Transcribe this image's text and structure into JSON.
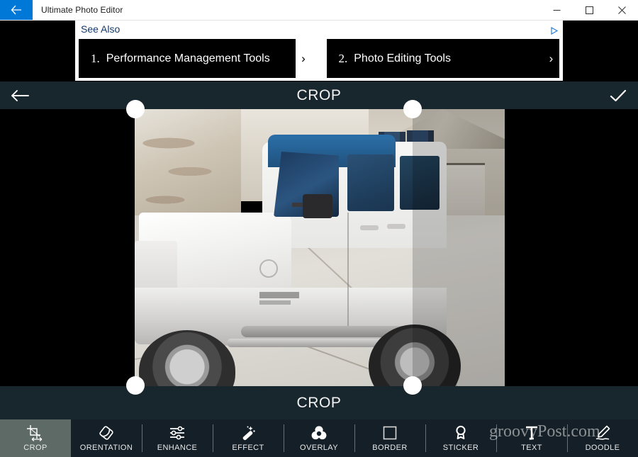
{
  "window": {
    "title": "Ultimate Photo Editor",
    "back_icon": "back-arrow-icon",
    "minimize_label": "─",
    "maximize_label": "□",
    "close_label": "✕"
  },
  "ad": {
    "heading": "See Also",
    "adchoices_icon": "adchoices-icon",
    "items": [
      {
        "number": "1.",
        "label": "Performance Management Tools",
        "arrow": "›"
      },
      {
        "number": "2.",
        "label": "Photo Editing Tools",
        "arrow": "›"
      }
    ]
  },
  "header": {
    "back_icon": "back-arrow-icon",
    "title": "CROP",
    "confirm_icon": "checkmark-icon"
  },
  "canvas": {
    "mode_label": "CROP",
    "handles": [
      "top-left",
      "top-right",
      "bottom-left",
      "bottom-right"
    ]
  },
  "toolbar": {
    "items": [
      {
        "label": "CROP",
        "icon": "crop-icon",
        "active": true
      },
      {
        "label": "ORENTATION",
        "icon": "orientation-icon",
        "active": false
      },
      {
        "label": "ENHANCE",
        "icon": "enhance-icon",
        "active": false
      },
      {
        "label": "EFFECT",
        "icon": "effect-icon",
        "active": false
      },
      {
        "label": "OVERLAY",
        "icon": "overlay-icon",
        "active": false
      },
      {
        "label": "BORDER",
        "icon": "border-icon",
        "active": false
      },
      {
        "label": "STICKER",
        "icon": "sticker-icon",
        "active": false
      },
      {
        "label": "TEXT",
        "icon": "text-icon",
        "active": false
      },
      {
        "label": "DOODLE",
        "icon": "doodle-icon",
        "active": false
      }
    ]
  },
  "watermark": {
    "text": "groovyPost.com"
  },
  "colors": {
    "titlebar_bg": "#ffffff",
    "accent_blue": "#0078d7",
    "panel_dark": "#18262e",
    "toolbar_bg": "#141f27",
    "active_tab": "#5e6a65",
    "canvas_bg": "#000000"
  }
}
